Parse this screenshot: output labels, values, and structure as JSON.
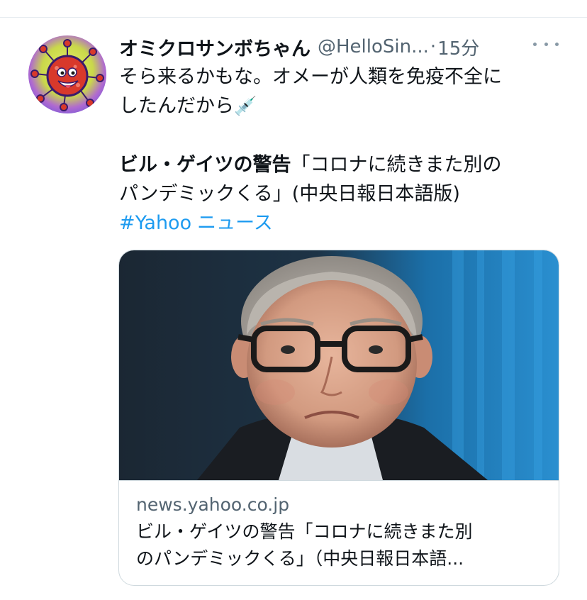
{
  "tweet": {
    "display_name": "オミクロサンボちゃん",
    "handle": "@HelloSin...",
    "separator": "·",
    "timestamp": "15分",
    "avatar_icon": "virus-mascot-icon",
    "more_icon": "more-icon",
    "text_line1": "そら来るかもな。オメーが人類を免疫不全に",
    "text_line2": "したんだから",
    "text_emoji": "💉",
    "headline_bold": "ビル・ゲイツの警告",
    "headline_rest1": "「コロナに続きまた別の",
    "headline_line2": "パンデミックくる」(中央日報日本語版)",
    "hashtag": "#Yahoo",
    "hashtag_suffix": "ニュース"
  },
  "card": {
    "domain": "news.yahoo.co.jp",
    "title_line1": "ビル・ゲイツの警告「コロナに続きまた別",
    "title_line2": "のパンデミックくる」（中央日報日本語..."
  },
  "colors": {
    "link": "#1d9bf0",
    "secondary_text": "#536471",
    "primary_text": "#0f1419",
    "border": "#cfd9de"
  }
}
